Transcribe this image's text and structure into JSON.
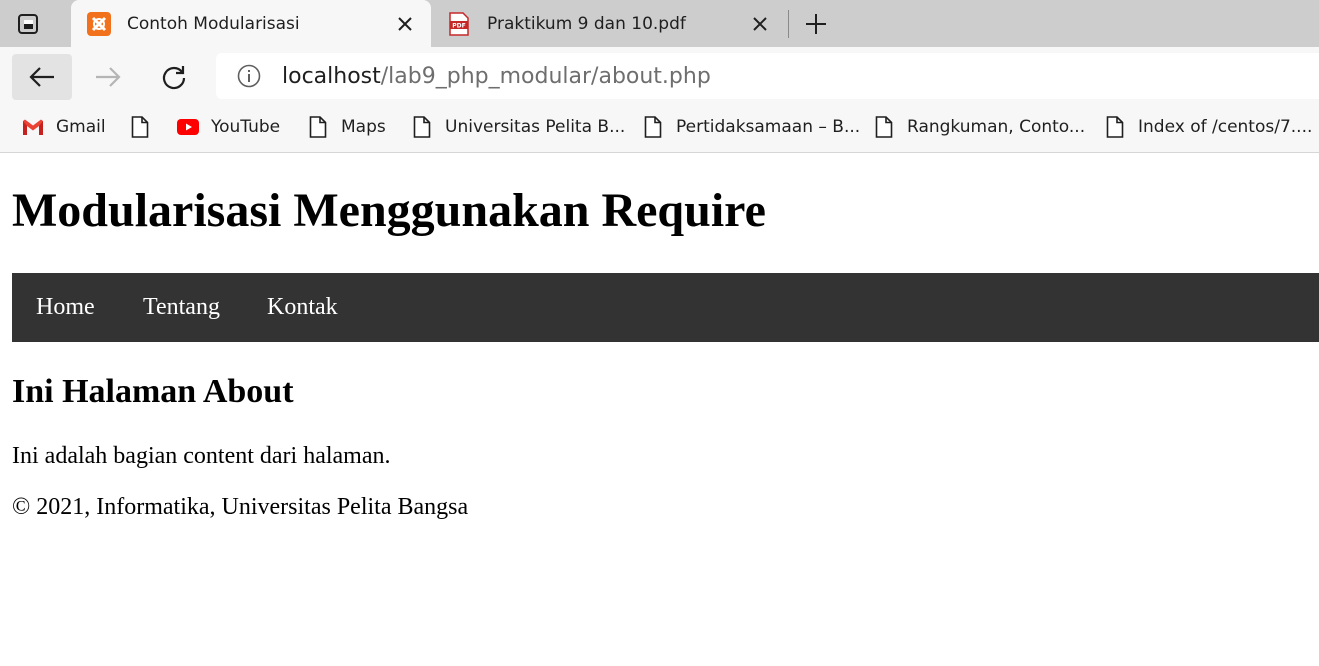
{
  "browser": {
    "tabs": [
      {
        "title": "Contoh Modularisasi",
        "icon": "xampp-icon",
        "active": true
      },
      {
        "title": "Praktikum 9 dan 10.pdf",
        "icon": "pdf-icon",
        "active": false
      }
    ],
    "url": {
      "host": "localhost",
      "path": "/lab9_php_modular/about.php"
    },
    "bookmarks": [
      {
        "label": "Gmail",
        "icon": "gmail-icon"
      },
      {
        "label": "",
        "icon": "page-icon"
      },
      {
        "label": "YouTube",
        "icon": "youtube-icon"
      },
      {
        "label": "Maps",
        "icon": "page-icon"
      },
      {
        "label": "Universitas Pelita B...",
        "icon": "page-icon"
      },
      {
        "label": "Pertidaksamaan – B...",
        "icon": "page-icon"
      },
      {
        "label": "Rangkuman, Conto...",
        "icon": "page-icon"
      },
      {
        "label": "Index of /centos/7....",
        "icon": "page-icon"
      }
    ]
  },
  "page": {
    "title": "Modularisasi Menggunakan Require",
    "nav": [
      "Home",
      "Tentang",
      "Kontak"
    ],
    "content_title": "Ini Halaman About",
    "content_text": "Ini adalah bagian content dari halaman.",
    "footer": "© 2021, Informatika, Universitas Pelita Bangsa"
  },
  "colors": {
    "nav_background": "#333333",
    "tab_bar": "#cdcdcd",
    "toolbar": "#f7f7f7"
  }
}
